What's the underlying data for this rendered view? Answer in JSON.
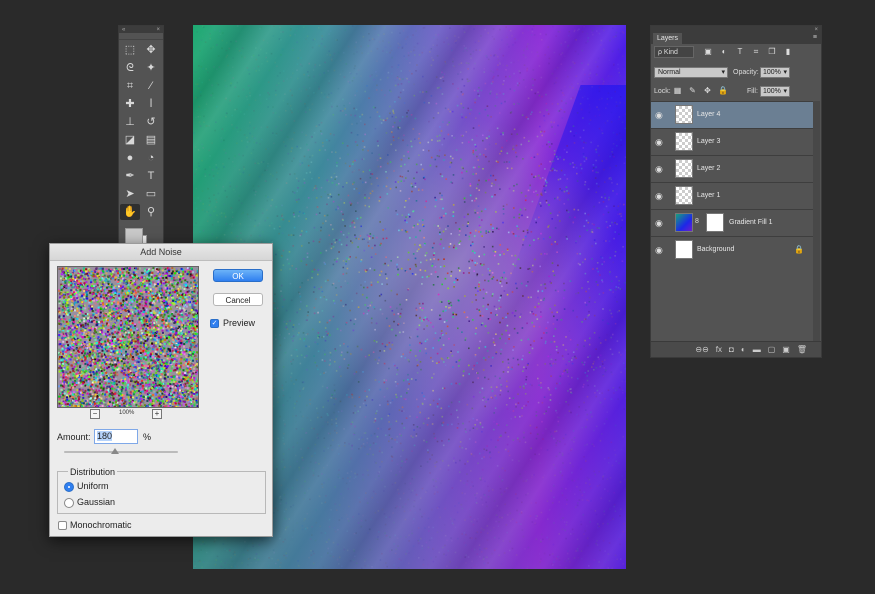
{
  "toolbar": {
    "collapse_glyph": "«",
    "close_glyph": "×",
    "tools": [
      {
        "icon": "marquee-icon",
        "glyph": "⬚"
      },
      {
        "icon": "move-icon",
        "glyph": "✥"
      },
      {
        "icon": "lasso-icon",
        "glyph": "ᘓ"
      },
      {
        "icon": "magic-wand-icon",
        "glyph": "✦"
      },
      {
        "icon": "crop-icon",
        "glyph": "⌗"
      },
      {
        "icon": "eyedropper-icon",
        "glyph": "⁄"
      },
      {
        "icon": "healing-brush-icon",
        "glyph": "✚"
      },
      {
        "icon": "brush-icon",
        "glyph": "ⅼ"
      },
      {
        "icon": "stamp-icon",
        "glyph": "⊥"
      },
      {
        "icon": "history-brush-icon",
        "glyph": "↺"
      },
      {
        "icon": "eraser-icon",
        "glyph": "◪"
      },
      {
        "icon": "gradient-icon",
        "glyph": "▤"
      },
      {
        "icon": "blur-icon",
        "glyph": "●"
      },
      {
        "icon": "dodge-icon",
        "glyph": "◔"
      },
      {
        "icon": "pen-icon",
        "glyph": "✒"
      },
      {
        "icon": "type-icon",
        "glyph": "T"
      },
      {
        "icon": "path-selection-icon",
        "glyph": "➤"
      },
      {
        "icon": "rectangle-icon",
        "glyph": "▭"
      },
      {
        "icon": "hand-icon",
        "glyph": "✋"
      },
      {
        "icon": "zoom-icon",
        "glyph": "⚲"
      }
    ]
  },
  "layers_panel": {
    "tab_label": "Layers",
    "menu_glyph": "≡",
    "close_glyph": "×",
    "kind_label": "ρ Kind",
    "filter_icons": [
      "▣",
      "◐",
      "T",
      "⌗",
      "❐",
      "▮"
    ],
    "blend_mode": "Normal",
    "opacity_label": "Opacity:",
    "opacity_value": "100%",
    "lock_label": "Lock:",
    "lock_icons": [
      "▦",
      "✎",
      "✥",
      "🔒"
    ],
    "fill_label": "Fill:",
    "fill_value": "100%",
    "eye_glyph": "◉",
    "chain_glyph": "8",
    "lock_glyph": "🔒",
    "layers": [
      {
        "name": "Layer 4",
        "type": "pixel",
        "selected": true
      },
      {
        "name": "Layer 3",
        "type": "pixel",
        "selected": false
      },
      {
        "name": "Layer 2",
        "type": "pixel",
        "selected": false
      },
      {
        "name": "Layer 1",
        "type": "pixel",
        "selected": false
      },
      {
        "name": "Gradient Fill 1",
        "type": "gradient",
        "selected": false
      },
      {
        "name": "Background",
        "type": "background",
        "selected": false
      }
    ],
    "bottom_icons": [
      "⊖⊖",
      "fx",
      "◘",
      "◐",
      "▬",
      "▢",
      "▣",
      "🗑"
    ]
  },
  "dialog": {
    "title": "Add Noise",
    "ok_label": "OK",
    "cancel_label": "Cancel",
    "preview_label": "Preview",
    "preview_checked": true,
    "zoom_out": "−",
    "zoom_in": "+",
    "zoom_level": "100%",
    "amount_label": "Amount:",
    "amount_value": "180",
    "amount_unit": "%",
    "amount_slider_fraction": 0.45,
    "distribution_label": "Distribution",
    "uniform_label": "Uniform",
    "gaussian_label": "Gaussian",
    "distribution_selected": "Uniform",
    "monochromatic_label": "Monochromatic",
    "monochromatic_checked": false
  }
}
